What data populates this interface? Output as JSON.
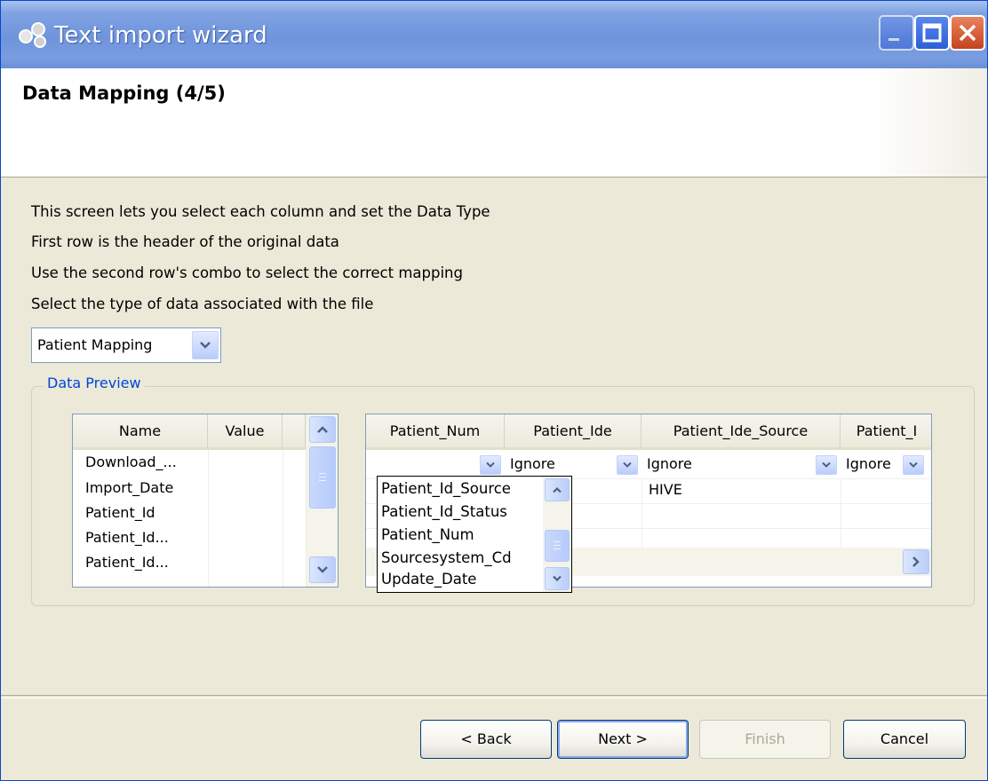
{
  "window": {
    "title": "Text import wizard",
    "icon": "app-icon",
    "controls": [
      "minimize-icon",
      "maximize-icon",
      "close-icon"
    ]
  },
  "header": {
    "title": "Data Mapping (4/5)"
  },
  "instructions": [
    "This screen lets you select each column and set the Data Type",
    "First row is the header of the original data",
    "Use the second row's combo to select the correct mapping",
    "Select the type of data associated with the file"
  ],
  "file_type": {
    "selected": "Patient Mapping"
  },
  "preview": {
    "label": "Data Preview",
    "name_value_table": {
      "columns": [
        "Name",
        "Value"
      ],
      "rows": [
        "Download_...",
        "Import_Date",
        "Patient_Id",
        "Patient_Id...",
        "Patient_Id..."
      ]
    },
    "data_table": {
      "columns": [
        "Patient_Num",
        "Patient_Ide",
        "Patient_Ide_Source",
        "Patient_I"
      ],
      "mapping_row": [
        "",
        "Ignore",
        "Ignore",
        "Ignore"
      ],
      "rows": [
        [
          "",
          "",
          "HIVE",
          ""
        ],
        [
          "",
          "",
          "",
          ""
        ],
        [
          "",
          "",
          "",
          ""
        ]
      ]
    },
    "mapping_dropdown_options": [
      "Patient_Id_Source",
      "Patient_Id_Status",
      "Patient_Num",
      "Sourcesystem_Cd",
      "Update_Date"
    ]
  },
  "buttons": {
    "back": "< Back",
    "next": "Next >",
    "finish": "Finish",
    "cancel": "Cancel"
  },
  "colors": {
    "title_bar": "#6f94dc",
    "close": "#c54220",
    "group_label": "#0046d5",
    "dialog_bg": "#ece9d8"
  }
}
